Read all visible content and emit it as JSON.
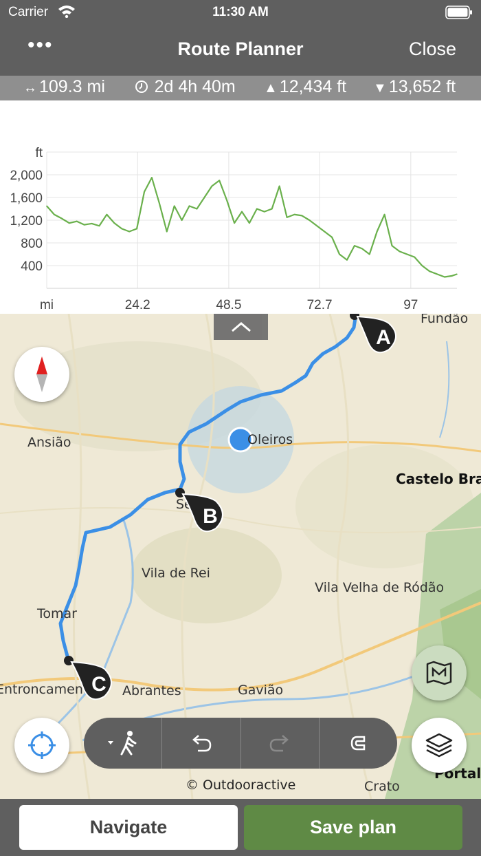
{
  "status_bar": {
    "carrier": "Carrier",
    "time": "11:30 AM"
  },
  "nav": {
    "more_label": "•••",
    "title": "Route Planner",
    "close_label": "Close"
  },
  "stats": {
    "distance": "109.3 mi",
    "duration": "2d 4h 40m",
    "ascent": "12,434 ft",
    "descent": "13,652 ft"
  },
  "chart_data": {
    "type": "line",
    "ylabel": "ft",
    "xlabel": "mi",
    "yticks": [
      "2,000",
      "1,600",
      "1,200",
      "800",
      "400"
    ],
    "xticks": [
      "mi",
      "24.2",
      "48.5",
      "72.7",
      "97"
    ],
    "ylim": [
      0,
      2400
    ],
    "xlim": [
      0,
      109.3
    ],
    "grid": true,
    "series": [
      {
        "x": [
          0,
          2,
          4,
          6,
          8,
          10,
          12,
          14,
          16,
          18,
          20,
          22,
          24,
          26,
          28,
          30,
          32,
          34,
          36,
          38,
          40,
          42,
          44,
          46,
          48,
          50,
          52,
          54,
          56,
          58,
          60,
          62,
          64,
          66,
          68,
          70,
          72,
          74,
          76,
          78,
          80,
          82,
          84,
          86,
          88,
          90,
          92,
          94,
          96,
          98,
          100,
          102,
          104,
          106,
          108,
          109.3
        ],
        "y": [
          1450,
          1300,
          1230,
          1150,
          1180,
          1120,
          1140,
          1100,
          1300,
          1150,
          1050,
          1000,
          1050,
          1700,
          1950,
          1500,
          1000,
          1450,
          1200,
          1450,
          1400,
          1600,
          1800,
          1900,
          1550,
          1150,
          1350,
          1150,
          1400,
          1350,
          1400,
          1800,
          1250,
          1300,
          1280,
          1200,
          1100,
          1000,
          900,
          600,
          500,
          750,
          700,
          600,
          1000,
          1300,
          750,
          650,
          600,
          550,
          400,
          300,
          250,
          200,
          220,
          250
        ]
      }
    ]
  },
  "map": {
    "places": [
      "Ansião",
      "Oleiros",
      "Castelo Bran",
      "Sertã",
      "Vila de Rei",
      "Vila Velha de Ródão",
      "Tomar",
      "Entroncamento",
      "Abrantes",
      "Gavião",
      "Crato",
      "Portale",
      "Fundão"
    ],
    "markers": [
      "A",
      "B",
      "C"
    ],
    "copyright": "© Outdooractive",
    "icons": [
      "compass-icon",
      "locate-icon",
      "walking-icon",
      "undo-icon",
      "redo-icon",
      "magnet-icon",
      "map-icon",
      "layers-icon"
    ]
  },
  "bottom": {
    "navigate_label": "Navigate",
    "save_label": "Save plan"
  },
  "colors": {
    "bar": "#5f5f5f",
    "stats_bar": "#8f8f8f",
    "route": "#3b8fe6",
    "accent_green": "#5f8a45",
    "profile": "#6ab04c"
  }
}
